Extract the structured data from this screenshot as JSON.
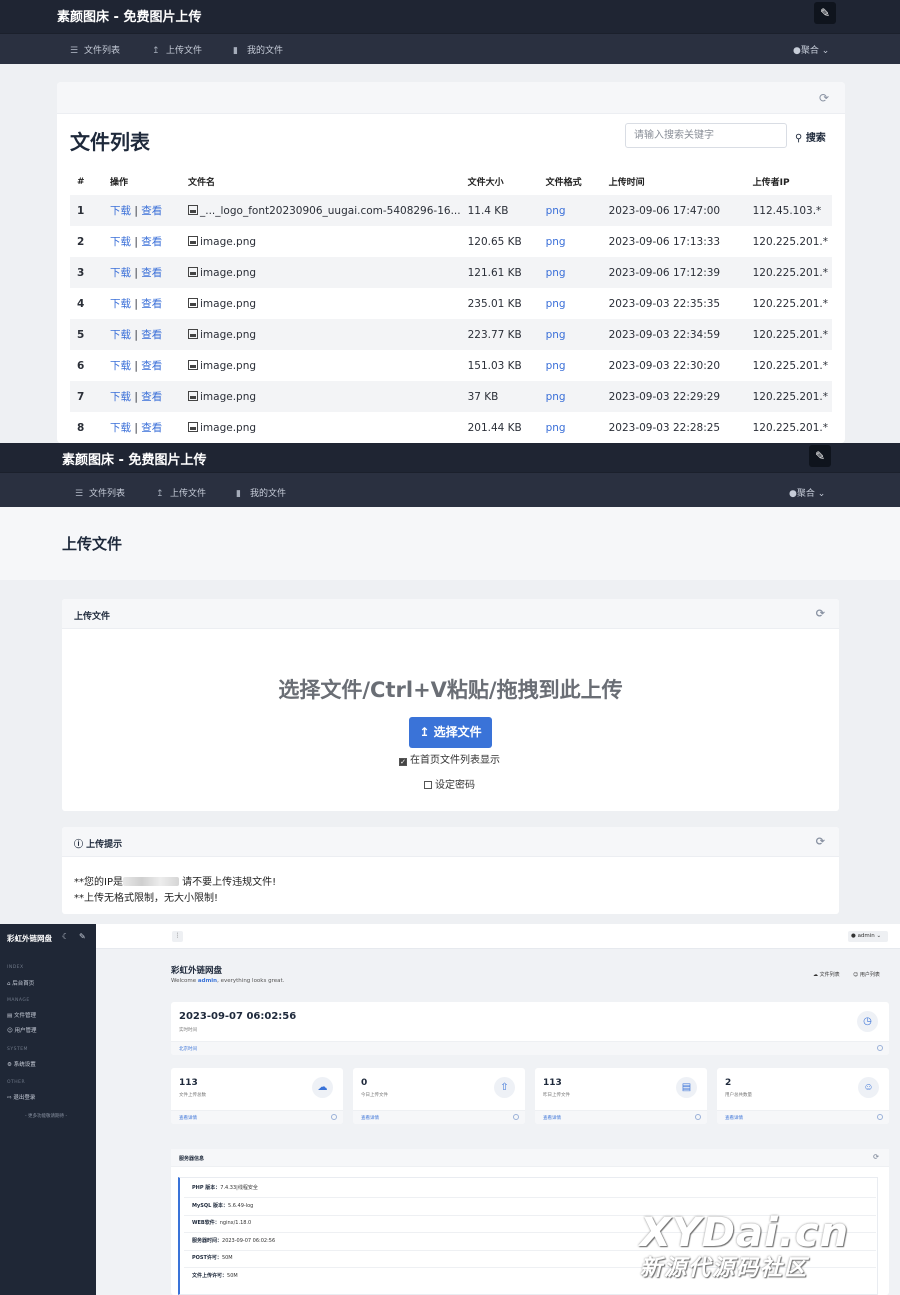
{
  "s1": {
    "app_title": "素颜图床 - 免费图片上传",
    "nav": [
      {
        "label": "文件列表"
      },
      {
        "label": "上传文件"
      },
      {
        "label": "我的文件"
      }
    ],
    "user": "聚合",
    "list_title": "文件列表",
    "search_placeholder": "请输入搜索关键字",
    "search_label": "搜索",
    "table": {
      "headers": [
        "#",
        "操作",
        "文件名",
        "文件大小",
        "文件格式",
        "上传时间",
        "上传者IP"
      ],
      "download_label": "下载",
      "view_label": "查看",
      "rows": [
        {
          "num": "1",
          "name": "_..._logo_font20230906_uugai.com-5408296-16...",
          "size": "11.4 KB",
          "format": "png",
          "time": "2023-09-06 17:47:00",
          "ip": "112.45.103.*"
        },
        {
          "num": "2",
          "name": "image.png",
          "size": "120.65 KB",
          "format": "png",
          "time": "2023-09-06 17:13:33",
          "ip": "120.225.201.*"
        },
        {
          "num": "3",
          "name": "image.png",
          "size": "121.61 KB",
          "format": "png",
          "time": "2023-09-06 17:12:39",
          "ip": "120.225.201.*"
        },
        {
          "num": "4",
          "name": "image.png",
          "size": "235.01 KB",
          "format": "png",
          "time": "2023-09-03 22:35:35",
          "ip": "120.225.201.*"
        },
        {
          "num": "5",
          "name": "image.png",
          "size": "223.77 KB",
          "format": "png",
          "time": "2023-09-03 22:34:59",
          "ip": "120.225.201.*"
        },
        {
          "num": "6",
          "name": "image.png",
          "size": "151.03 KB",
          "format": "png",
          "time": "2023-09-03 22:30:20",
          "ip": "120.225.201.*"
        },
        {
          "num": "7",
          "name": "image.png",
          "size": "37 KB",
          "format": "png",
          "time": "2023-09-03 22:29:29",
          "ip": "120.225.201.*"
        },
        {
          "num": "8",
          "name": "image.png",
          "size": "201.44 KB",
          "format": "png",
          "time": "2023-09-03 22:28:25",
          "ip": "120.225.201.*"
        }
      ]
    }
  },
  "s2": {
    "app_title": "素颜图床 - 免费图片上传",
    "nav": [
      {
        "label": "文件列表"
      },
      {
        "label": "上传文件"
      },
      {
        "label": "我的文件"
      }
    ],
    "user": "聚合",
    "page_title": "上传文件",
    "upload_block_title": "上传文件",
    "upload_hint": "选择文件/Ctrl+V粘贴/拖拽到此上传",
    "upload_button": "选择文件",
    "show_on_home": "在首页文件列表显示",
    "set_password": "设定密码",
    "tips_title": "上传提示",
    "tip1_prefix": "**您的IP是",
    "tip1_suffix": "请不要上传违规文件!",
    "tip2": "**上传无格式限制，无大小限制!"
  },
  "s3": {
    "brand": "彩虹外链网盘",
    "sections": [
      {
        "label": "INDEX",
        "items": [
          "后台首页"
        ]
      },
      {
        "label": "MANAGE",
        "items": [
          "文件管理",
          "用户管理"
        ]
      },
      {
        "label": "SYSTEM",
        "items": [
          "系统设置"
        ]
      },
      {
        "label": "OTHER",
        "items": [
          "退出登录"
        ]
      }
    ],
    "more": "- 更多功能敬请期待 -",
    "admin": "admin",
    "title": "彩虹外链网盘",
    "welcome_prefix": "Welcome",
    "welcome_user": "admin",
    "welcome_suffix": ", everything looks great.",
    "link_files": "文件列表",
    "link_users": "用户列表",
    "time_value": "2023-09-07 06:02:56",
    "time_label": "实时时间",
    "time_foot": "北京时间",
    "stats": [
      {
        "value": "113",
        "label": "文件上传总数",
        "foot": "查看详情",
        "icon": "cloud-icon"
      },
      {
        "value": "0",
        "label": "今日上传文件",
        "foot": "查看详情",
        "icon": "cloud-upload-icon"
      },
      {
        "value": "113",
        "label": "昨日上传文件",
        "foot": "查看详情",
        "icon": "inbox-icon"
      },
      {
        "value": "2",
        "label": "用户总共数量",
        "foot": "查看详情",
        "icon": "users-icon"
      }
    ],
    "server_title": "服务器信息",
    "server": [
      {
        "k": "PHP 版本：",
        "v": "7.4.33|线程安全"
      },
      {
        "k": "MySQL 版本：",
        "v": "5.6.49-log"
      },
      {
        "k": "WEB软件：",
        "v": "nginx/1.18.0"
      },
      {
        "k": "服务器时间：",
        "v": "2023-09-07 06:02:56"
      },
      {
        "k": "POST许可：",
        "v": "50M"
      },
      {
        "k": "文件上传许可：",
        "v": "50M"
      }
    ]
  },
  "watermark": {
    "line1": "XYDai.cn",
    "line2": "新源代源码社区"
  },
  "colors": {
    "navbar": "#1f2533",
    "accent": "#3a73d8",
    "sidebar": "#1f2736"
  }
}
